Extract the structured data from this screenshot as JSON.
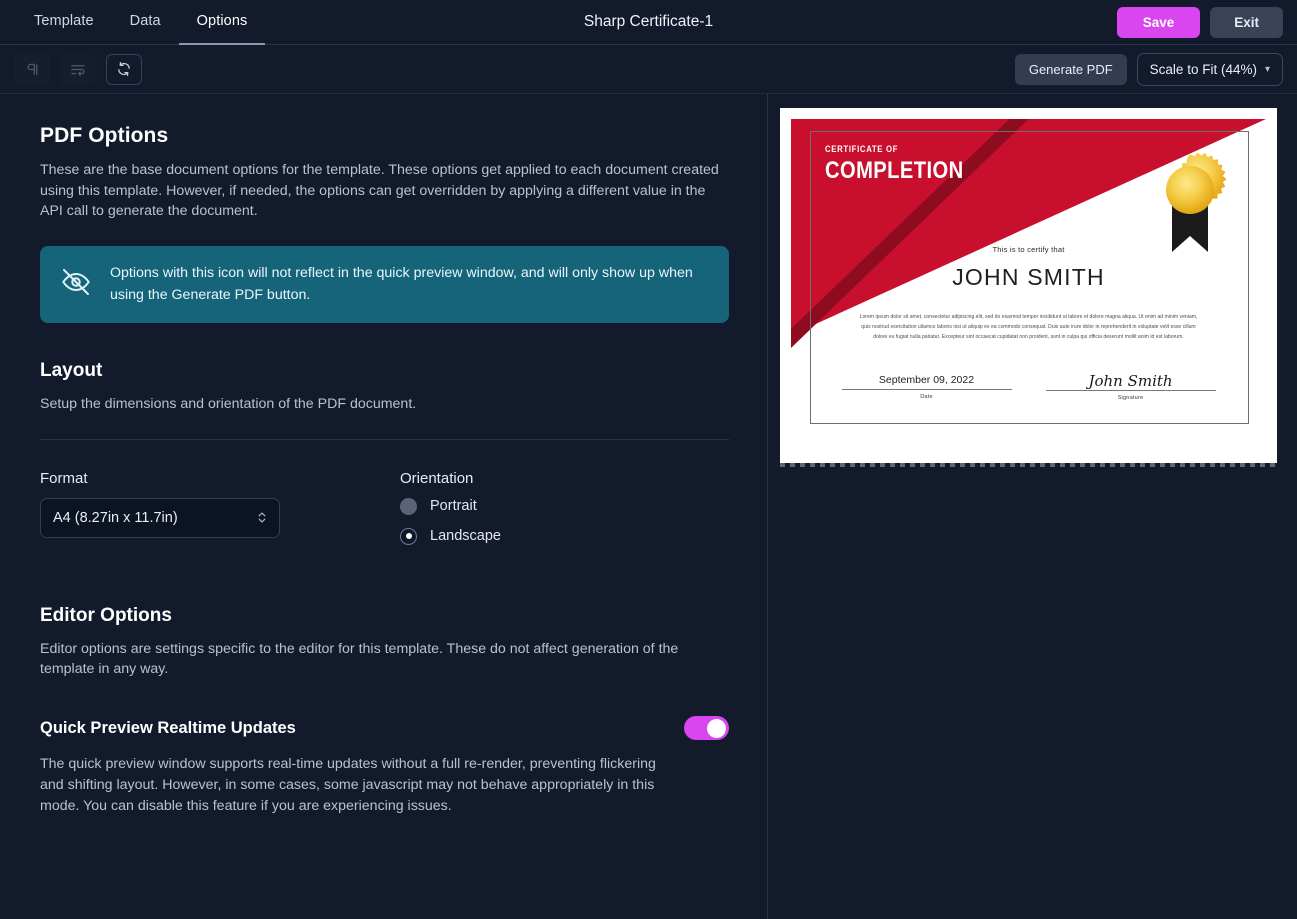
{
  "header": {
    "tabs": [
      {
        "label": "Template",
        "active": false
      },
      {
        "label": "Data",
        "active": false
      },
      {
        "label": "Options",
        "active": true
      }
    ],
    "document_title": "Sharp Certificate-1",
    "save_label": "Save",
    "exit_label": "Exit",
    "accent_color": "#d946ef"
  },
  "toolbar": {
    "buttons": [
      {
        "name": "paragraph-icon",
        "state": "disabled"
      },
      {
        "name": "text-wrap-icon",
        "state": "disabled"
      },
      {
        "name": "refresh-icon",
        "state": "enabled"
      }
    ],
    "generate_pdf_label": "Generate PDF",
    "scale_label": "Scale to Fit (44%)"
  },
  "pdf_options": {
    "title": "PDF Options",
    "description": "These are the base document options for the template. These options get applied to each document created using this template. However, if needed, the options can get overridden by applying a different value in the API call to generate the document.",
    "notice": {
      "text": "Options with this icon will not reflect in the quick preview window, and will only show up when using the Generate PDF button.",
      "icon": "eye-off-icon",
      "background_color": "#15647a"
    }
  },
  "layout": {
    "title": "Layout",
    "description": "Setup the dimensions and orientation of the PDF document.",
    "format_label": "Format",
    "format_value": "A4 (8.27in x 11.7in)",
    "orientation_label": "Orientation",
    "orientation_options": [
      {
        "label": "Portrait",
        "selected": false
      },
      {
        "label": "Landscape",
        "selected": true
      }
    ]
  },
  "editor_options": {
    "title": "Editor Options",
    "description": "Editor options are settings specific to the editor for this template. These do not affect generation of the template in any way.",
    "quick_preview": {
      "label": "Quick Preview Realtime Updates",
      "enabled": true,
      "description": "The quick preview window supports real-time updates without a full re-render, preventing flickering and shifting layout. However, in some cases, some javascript may not behave appropriately in this mode. You can disable this feature if you are experiencing issues."
    }
  },
  "preview": {
    "certificate": {
      "kicker": "CERTIFICATE OF",
      "title": "COMPLETION",
      "certify_line": "This is to certify that",
      "recipient": "JOHN SMITH",
      "body": "Lorem ipsum dolor sit amet, consectetur adipiscing elit, sed do eiusmod tempor incididunt ut labore et dolore magna aliqua. Ut enim ad minim veniam, quis nostrud exercitation ullamco laboris nisi ut aliquip ex ea commodo consequat. Duis aute irure dolor in reprehenderit in voluptate velit esse cillum dolore eu fugiat nulla pariatur. Excepteur sint occaecat cupidatat non proident, sunt in culpa qui officia deserunt mollit anim id est laborum.",
      "date_value": "September 09, 2022",
      "date_caption": "Date",
      "signature_value": "John Smith",
      "signature_caption": "Signature",
      "banner_color": "#c8102e",
      "seal_color": "#f0b323"
    }
  }
}
